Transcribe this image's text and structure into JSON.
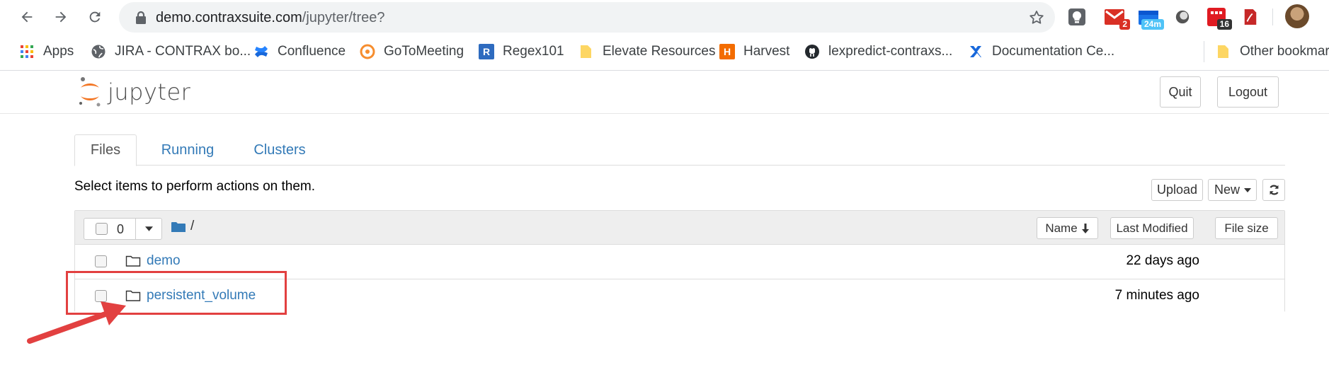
{
  "browser": {
    "url_host": "demo.contraxsuite.com",
    "url_path": "/jupyter/tree?",
    "extensions": [
      {
        "name": "lightbulb-ext-icon",
        "badge": ""
      },
      {
        "name": "gmail-ext-icon",
        "badge": "2",
        "badge_color": "#d93025"
      },
      {
        "name": "calendar-ext-icon",
        "badge": "24m",
        "badge_color": "#4fc3f7"
      },
      {
        "name": "circle-ext-icon",
        "badge": ""
      },
      {
        "name": "toggl-ext-icon",
        "badge": "16",
        "badge_color": "#333333"
      },
      {
        "name": "pdf-ext-icon",
        "badge": ""
      }
    ],
    "bookmarks": [
      {
        "label": "Apps",
        "icon": "apps-grid-icon"
      },
      {
        "label": "JIRA - CONTRAX bo...",
        "icon": "globe-icon"
      },
      {
        "label": "Confluence",
        "icon": "confluence-icon"
      },
      {
        "label": "GoToMeeting",
        "icon": "gotomeeting-icon"
      },
      {
        "label": "Regex101",
        "icon": "regex-icon"
      },
      {
        "label": "Elevate Resources",
        "icon": "folder-bookmark-icon"
      },
      {
        "label": "Harvest",
        "icon": "harvest-icon"
      },
      {
        "label": "lexpredict-contraxs...",
        "icon": "github-icon"
      },
      {
        "label": "Documentation Ce...",
        "icon": "confluence-x-icon"
      },
      {
        "label": "Other bookmarks",
        "icon": "folder-bookmark-icon"
      }
    ]
  },
  "header": {
    "logo_text": "jupyter",
    "quit_label": "Quit",
    "logout_label": "Logout"
  },
  "tabs": [
    {
      "label": "Files",
      "active": true
    },
    {
      "label": "Running",
      "active": false
    },
    {
      "label": "Clusters",
      "active": false
    }
  ],
  "toolbar": {
    "instructions": "Select items to perform actions on them.",
    "upload_label": "Upload",
    "new_label": "New",
    "refresh_icon": "refresh-icon"
  },
  "list_header": {
    "selected_count": "0",
    "path": "/",
    "name_label": "Name",
    "last_modified_label": "Last Modified",
    "file_size_label": "File size"
  },
  "items": [
    {
      "name": "demo",
      "modified": "22 days ago",
      "type": "folder"
    },
    {
      "name": "persistent_volume",
      "modified": "7 minutes ago",
      "type": "folder"
    }
  ],
  "colors": {
    "link": "#337ab7",
    "annotation": "#e24040",
    "jupyter_orange": "#f37726"
  }
}
